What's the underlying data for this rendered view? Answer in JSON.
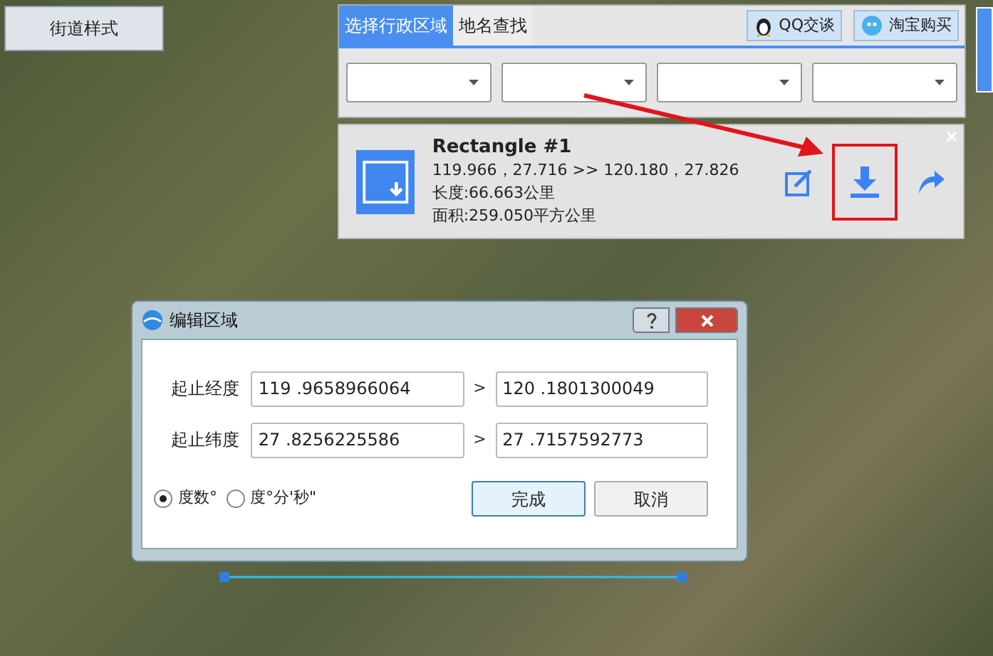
{
  "style_button": "街道样式",
  "tabs": [
    {
      "label": "选择行政区域",
      "selected": true
    },
    {
      "label": "地名查找",
      "selected": false
    }
  ],
  "top_buttons": [
    {
      "kind": "qq",
      "label": "QQ交谈"
    },
    {
      "kind": "taobao",
      "label": "淘宝购买"
    }
  ],
  "shape_card": {
    "title": "Rectangle #1",
    "coords": "119.966，27.716 >> 120.180，27.826",
    "length": "长度:66.663公里",
    "area": "面积:259.050平方公里",
    "actions": [
      {
        "kind": "edit",
        "highlighted": false
      },
      {
        "kind": "download",
        "highlighted": true
      },
      {
        "kind": "share",
        "highlighted": false
      }
    ]
  },
  "dialog": {
    "title": "编辑区域",
    "rows": [
      {
        "label": "起止经度",
        "from": "119 .9658966064",
        "separator": ">",
        "to": "120 .1801300049"
      },
      {
        "label": "起止纬度",
        "from": "27 .8256225586",
        "separator": ">",
        "to": "27 .7157592773"
      }
    ],
    "radios": [
      {
        "label": "度数°",
        "selected": true
      },
      {
        "label": "度°分'秒\"",
        "selected": false
      }
    ],
    "buttons": [
      {
        "label": "完成",
        "default": true
      },
      {
        "label": "取消",
        "default": false
      }
    ]
  }
}
